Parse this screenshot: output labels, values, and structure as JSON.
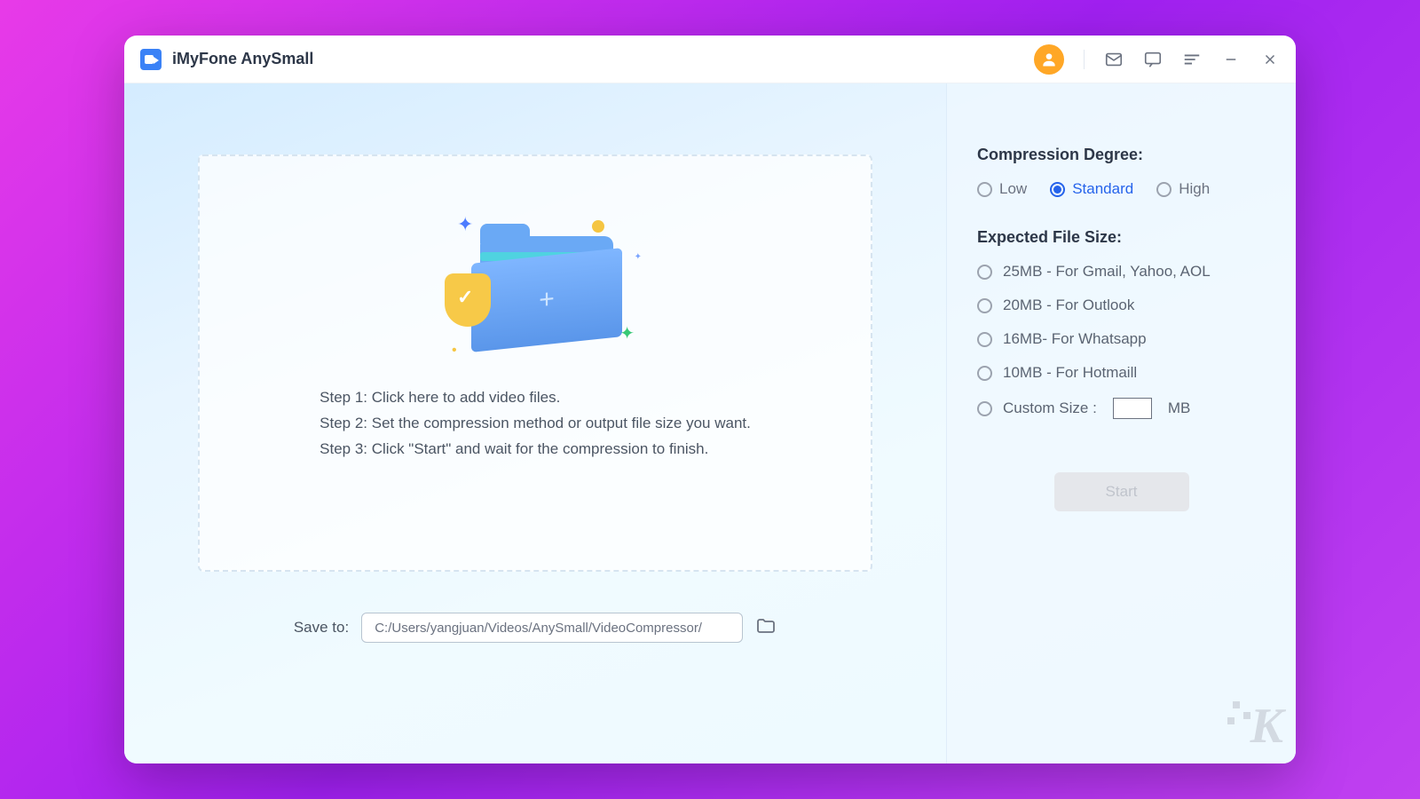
{
  "app": {
    "title": "iMyFone AnySmall"
  },
  "dropzone": {
    "step1": "Step 1: Click here to add video files.",
    "step2": "Step 2: Set the compression method or output file size you want.",
    "step3": "Step 3: Click \"Start\" and wait for the compression to finish."
  },
  "save": {
    "label": "Save to:",
    "path": "C:/Users/yangjuan/Videos/AnySmall/VideoCompressor/"
  },
  "sidebar": {
    "compression_title": "Compression Degree:",
    "degrees": {
      "low": "Low",
      "standard": "Standard",
      "high": "High",
      "selected": "standard"
    },
    "size_title": "Expected File Size:",
    "sizes": [
      "25MB - For Gmail, Yahoo, AOL",
      "20MB - For Outlook",
      "16MB- For Whatsapp",
      "10MB - For Hotmaill"
    ],
    "custom_label": "Custom Size :",
    "custom_unit": "MB",
    "start_label": "Start"
  },
  "watermark": "K"
}
